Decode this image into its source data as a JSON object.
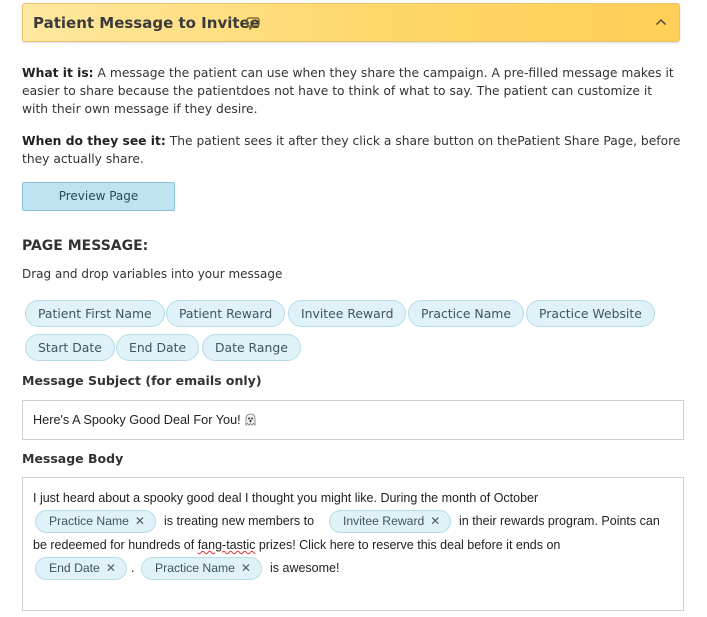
{
  "section": {
    "title": "Patient Message to Invitee"
  },
  "info": {
    "what_label": "What it is:",
    "what_text": " A message the patient can use when they share the campaign. A pre-filled message makes it easier to share because the patientdoes not have to think of what to say. The patient can customize it with their own message if they desire.",
    "when_label": "When do they see it:",
    "when_text": " The patient sees it after they click a share button on thePatient Share Page, before they actually share."
  },
  "preview_button": "Preview Page",
  "page_message": {
    "heading": "PAGE MESSAGE:",
    "hint": "Drag and drop variables into your message",
    "variables": [
      "Patient First Name",
      "Patient Reward",
      "Invitee Reward",
      "Practice Name",
      "Practice Website",
      "Start Date",
      "End Date",
      "Date Range"
    ]
  },
  "subject": {
    "label": "Message Subject (for emails only)",
    "value": "Here's A Spooky Good Deal For You!"
  },
  "body": {
    "label": "Message Body",
    "line1": "I just heard about a spooky good deal I thought you might like. During the month of October",
    "token_practice_name": "Practice Name",
    "text_treating": "is treating new members to",
    "token_invitee_reward": "Invitee Reward",
    "text_rewards": "in their rewards program. Points can",
    "line3_pre": "be redeemed for hundreds of ",
    "line3_squig": "fang-tastic",
    "line3_post": " prizes! Click here to reserve this deal before it ends on",
    "token_end_date": "End Date",
    "text_dot": ".",
    "token_practice_name_2": "Practice Name",
    "text_awesome": "is awesome!",
    "remove_glyph": "✕"
  }
}
